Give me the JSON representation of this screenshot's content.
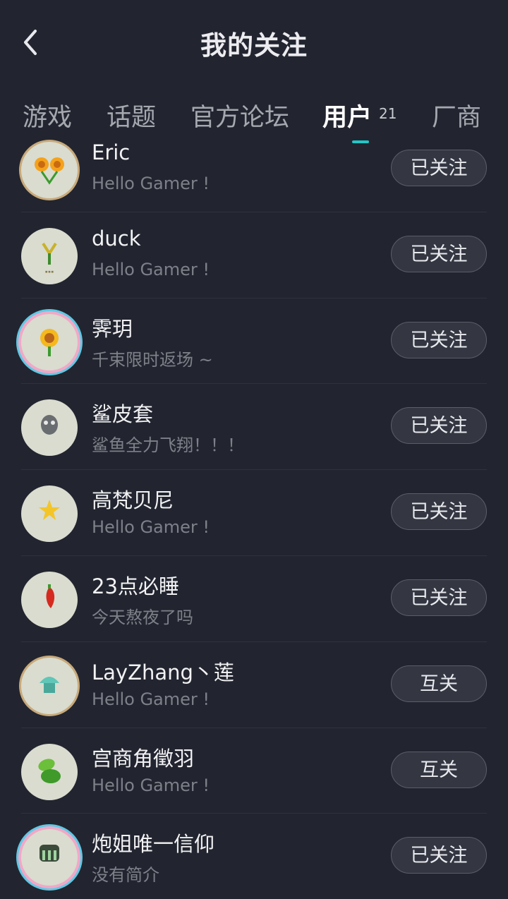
{
  "header": {
    "title": "我的关注"
  },
  "tabs": [
    {
      "label": "游戏"
    },
    {
      "label": "话题"
    },
    {
      "label": "官方论坛"
    },
    {
      "label": "用户",
      "count": "21"
    },
    {
      "label": "厂商"
    }
  ],
  "active_tab": "用户",
  "colors": {
    "accent": "#20c8c8",
    "background": "#22252f"
  },
  "users": [
    {
      "name": "Eric",
      "bio": "Hello Gamer !",
      "button": "已关注",
      "avatar_icon": "twin-sunflower-icon"
    },
    {
      "name": "duck",
      "bio": "Hello Gamer !",
      "button": "已关注",
      "avatar_icon": "plant-icon"
    },
    {
      "name": "霁玥",
      "bio": "千束限时返场 ~",
      "button": "已关注",
      "avatar_icon": "sunflower-icon"
    },
    {
      "name": "鲨皮套",
      "bio": "鲨鱼全力飞翔！！！",
      "button": "已关注",
      "avatar_icon": "zombie-head-icon"
    },
    {
      "name": "高梵贝尼",
      "bio": "Hello Gamer !",
      "button": "已关注",
      "avatar_icon": "starfruit-icon"
    },
    {
      "name": "23点必睡",
      "bio": "今天熬夜了吗",
      "button": "已关注",
      "avatar_icon": "jalapeno-icon"
    },
    {
      "name": "LayZhang丶莲",
      "bio": "Hello Gamer !",
      "button": "互关",
      "avatar_icon": "ice-plant-icon"
    },
    {
      "name": "宫商角徵羽",
      "bio": "Hello Gamer !",
      "button": "互关",
      "avatar_icon": "leaf-pea-icon"
    },
    {
      "name": "炮姐唯一信仰",
      "bio": "没有简介",
      "button": "已关注",
      "avatar_icon": "grave-buster-icon"
    }
  ]
}
